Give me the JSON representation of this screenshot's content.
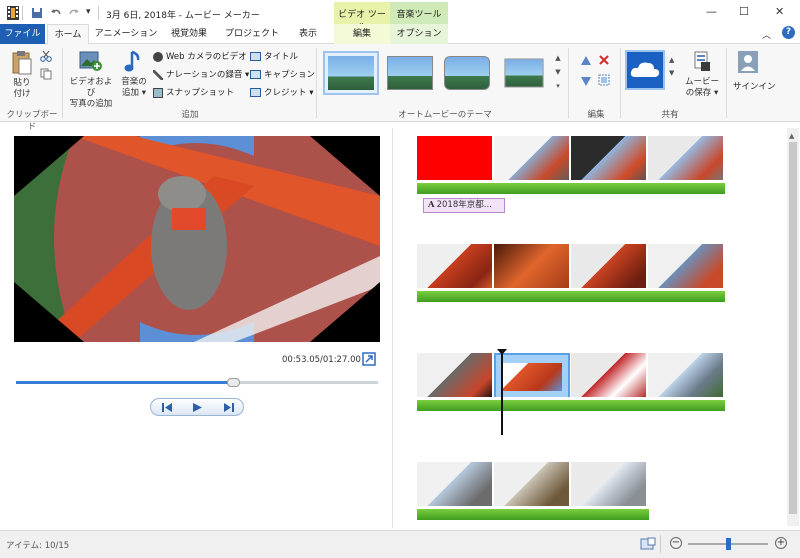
{
  "window": {
    "title": "3月 6日, 2018年 - ムービー メーカー",
    "min_glyph": "—",
    "max_glyph": "☐",
    "close_glyph": "✕",
    "help_glyph": "?"
  },
  "context_tabs": {
    "video_tools": "ビデオ ツール",
    "music_tools": "音楽ツール"
  },
  "tabs": {
    "file": "ファイル",
    "home": "ホーム",
    "animation": "アニメーション",
    "visual_effects": "視覚効果",
    "project": "プロジェクト",
    "view": "表示",
    "edit": "編集",
    "options": "オプション"
  },
  "ribbon": {
    "paste_l1": "貼り",
    "paste_l2": "付け",
    "clipboard": "クリップボード",
    "add_photos_l1": "ビデオおよび",
    "add_photos_l2": "写真の追加",
    "add_music_l1": "音楽の",
    "add_music_l2": "追加 ▾",
    "webcam": "Web カメラのビデオ",
    "narration": "ナレーションの録音 ▾",
    "snapshot": "スナップショット",
    "title": "タイトル",
    "caption": "キャプション",
    "credits": "クレジット ▾",
    "add_group": "追加",
    "automovie_group": "オートムービーのテーマ",
    "edit_group": "編集",
    "save_movie_l1": "ムービー",
    "save_movie_l2": "の保存 ▾",
    "signin": "サインイン",
    "share_group": "共有"
  },
  "player": {
    "time": "00:53.05/01:27.00",
    "progress": 0.6
  },
  "storyboard": {
    "caption_label": "2018年京都..."
  },
  "status": {
    "items": "アイテム: 10/15",
    "zoom_out": "−",
    "zoom_in": "+",
    "zoom_level": 0.5
  },
  "colors": {
    "file_tab": "#1e5fb4",
    "video_tools": "#e8f2a8",
    "music_tools": "#cfe9b8",
    "accent": "#3a7dd8"
  }
}
